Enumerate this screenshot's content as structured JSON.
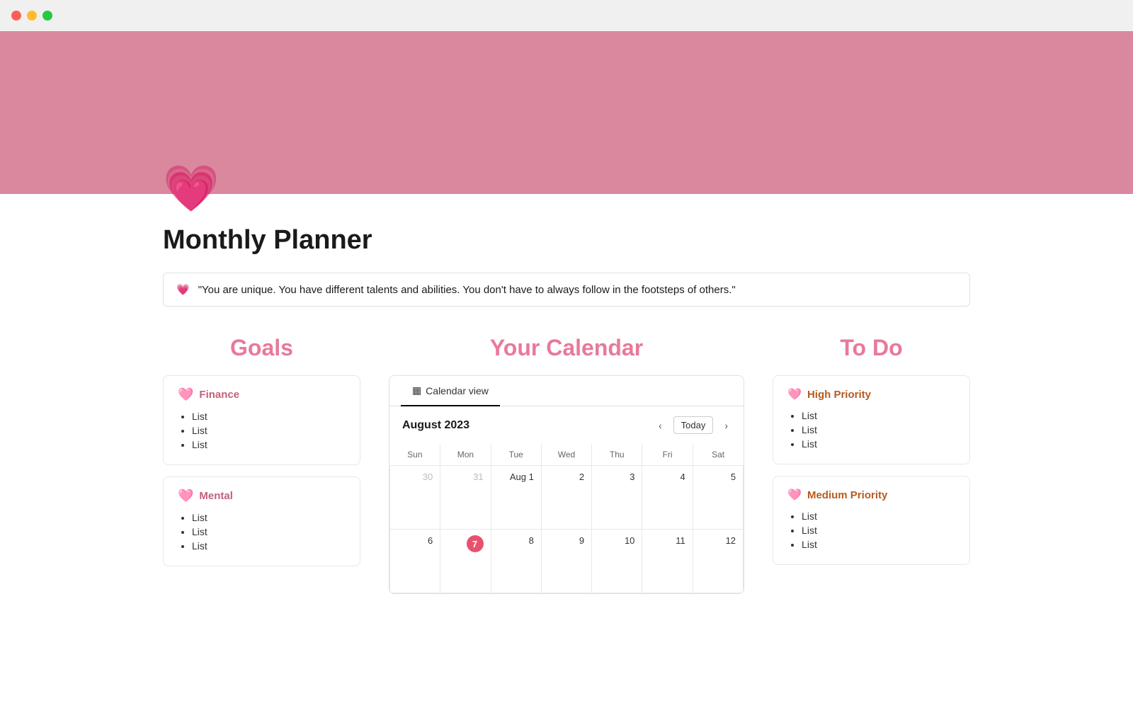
{
  "titlebar": {
    "close_label": "",
    "minimize_label": "",
    "maximize_label": ""
  },
  "page": {
    "icon": "💗",
    "title": "Monthly Planner",
    "quote_icon": "💗",
    "quote": "\"You are unique. You have different talents and abilities. You don't have to always follow in the footsteps of others.\""
  },
  "goals": {
    "section_title": "Goals",
    "cards": [
      {
        "id": "finance",
        "icon": "🩷",
        "title": "Finance",
        "items": [
          "List",
          "List",
          "List"
        ]
      },
      {
        "id": "mental",
        "icon": "🩷",
        "title": "Mental",
        "items": [
          "List",
          "List",
          "List"
        ]
      }
    ]
  },
  "calendar": {
    "section_title": "Your Calendar",
    "tab_label": "Calendar view",
    "month": "August 2023",
    "today_label": "Today",
    "days_of_week": [
      "Sun",
      "Mon",
      "Tue",
      "Wed",
      "Thu",
      "Fri",
      "Sat"
    ],
    "rows": [
      [
        {
          "day": "30",
          "other": true
        },
        {
          "day": "31",
          "other": true
        },
        {
          "day": "Aug 1"
        },
        {
          "day": "2"
        },
        {
          "day": "3"
        },
        {
          "day": "4"
        },
        {
          "day": "5"
        }
      ],
      [
        {
          "day": "6"
        },
        {
          "day": "7",
          "today": true
        },
        {
          "day": "8"
        },
        {
          "day": "9"
        },
        {
          "day": "10"
        },
        {
          "day": "11"
        },
        {
          "day": "12"
        }
      ]
    ]
  },
  "todo": {
    "section_title": "To Do",
    "cards": [
      {
        "id": "high-priority",
        "icon": "🩷",
        "title": "High Priority",
        "items": [
          "List",
          "List",
          "List"
        ]
      },
      {
        "id": "medium-priority",
        "icon": "🩷",
        "title": "Medium Priority",
        "items": [
          "List",
          "List",
          "List"
        ]
      }
    ]
  }
}
